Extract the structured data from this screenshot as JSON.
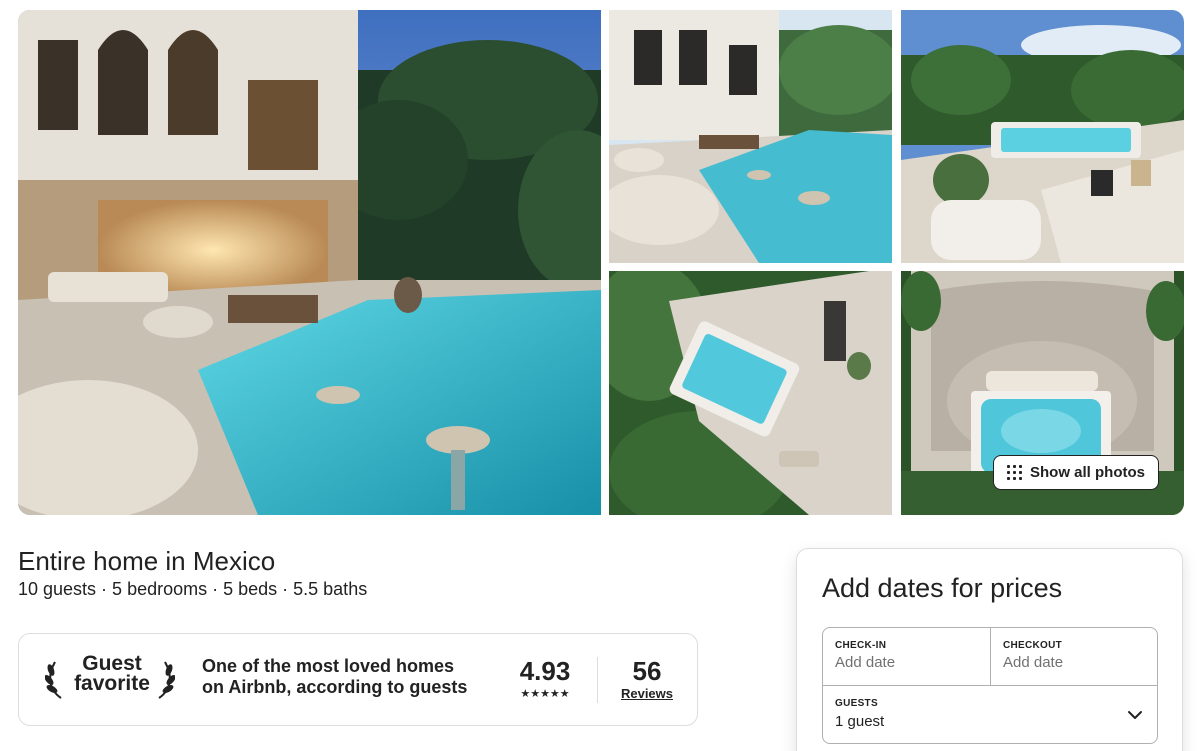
{
  "gallery": {
    "show_all_label": "Show all photos",
    "photos": [
      {
        "alt": "villa-pool-evening"
      },
      {
        "alt": "villa-pool-terrace"
      },
      {
        "alt": "rooftop-jacuzzi"
      },
      {
        "alt": "aerial-jacuzzi"
      },
      {
        "alt": "aerial-plunge-pool"
      }
    ]
  },
  "listing": {
    "title": "Entire home in Mexico",
    "subtitle": "10 guests · 5 bedrooms · 5 beds · 5.5 baths"
  },
  "favorite": {
    "badge_line1": "Guest",
    "badge_line2": "favorite",
    "description": "One of the most loved homes on Airbnb, according to guests",
    "rating": "4.93",
    "stars": "★★★★★",
    "star_count": 5,
    "reviews_count": "56",
    "reviews_label": "Reviews"
  },
  "booking": {
    "title": "Add dates for prices",
    "checkin_label": "CHECK-IN",
    "checkin_value": "Add date",
    "checkout_label": "CHECKOUT",
    "checkout_value": "Add date",
    "guests_label": "GUESTS",
    "guests_value": "1 guest"
  },
  "colors": {
    "text": "#222222",
    "muted": "#717171",
    "border": "#dddddd",
    "pool": "#3fc6d8"
  }
}
